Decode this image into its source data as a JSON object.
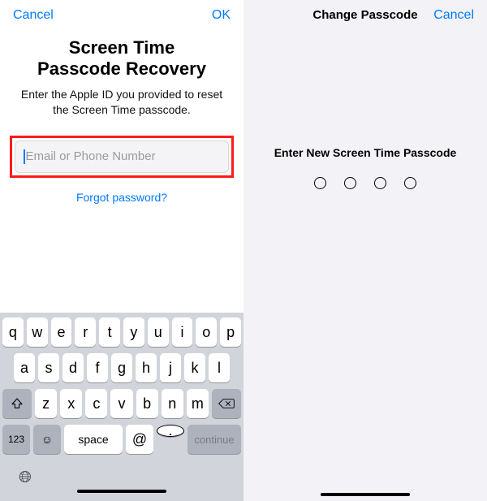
{
  "left": {
    "nav": {
      "cancel": "Cancel",
      "ok": "OK"
    },
    "title_line1": "Screen Time",
    "title_line2": "Passcode Recovery",
    "subtitle": "Enter the Apple ID you provided to reset the Screen Time passcode.",
    "input": {
      "placeholder": "Email or Phone Number",
      "value": ""
    },
    "forgot": "Forgot password?",
    "keyboard": {
      "row1": [
        "q",
        "w",
        "e",
        "r",
        "t",
        "y",
        "u",
        "i",
        "o",
        "p"
      ],
      "row2": [
        "a",
        "s",
        "d",
        "f",
        "g",
        "h",
        "j",
        "k",
        "l"
      ],
      "row3": [
        "z",
        "x",
        "c",
        "v",
        "b",
        "n",
        "m"
      ],
      "n123": "123",
      "space": "space",
      "at": "@",
      "dot": ".",
      "continue": "continue"
    }
  },
  "right": {
    "nav": {
      "title": "Change Passcode",
      "cancel": "Cancel"
    },
    "prompt": "Enter New Screen Time Passcode",
    "passcode_length": 4,
    "filled": 0
  },
  "colors": {
    "accent": "#007aff",
    "highlight_border": "#ff1a1a"
  }
}
